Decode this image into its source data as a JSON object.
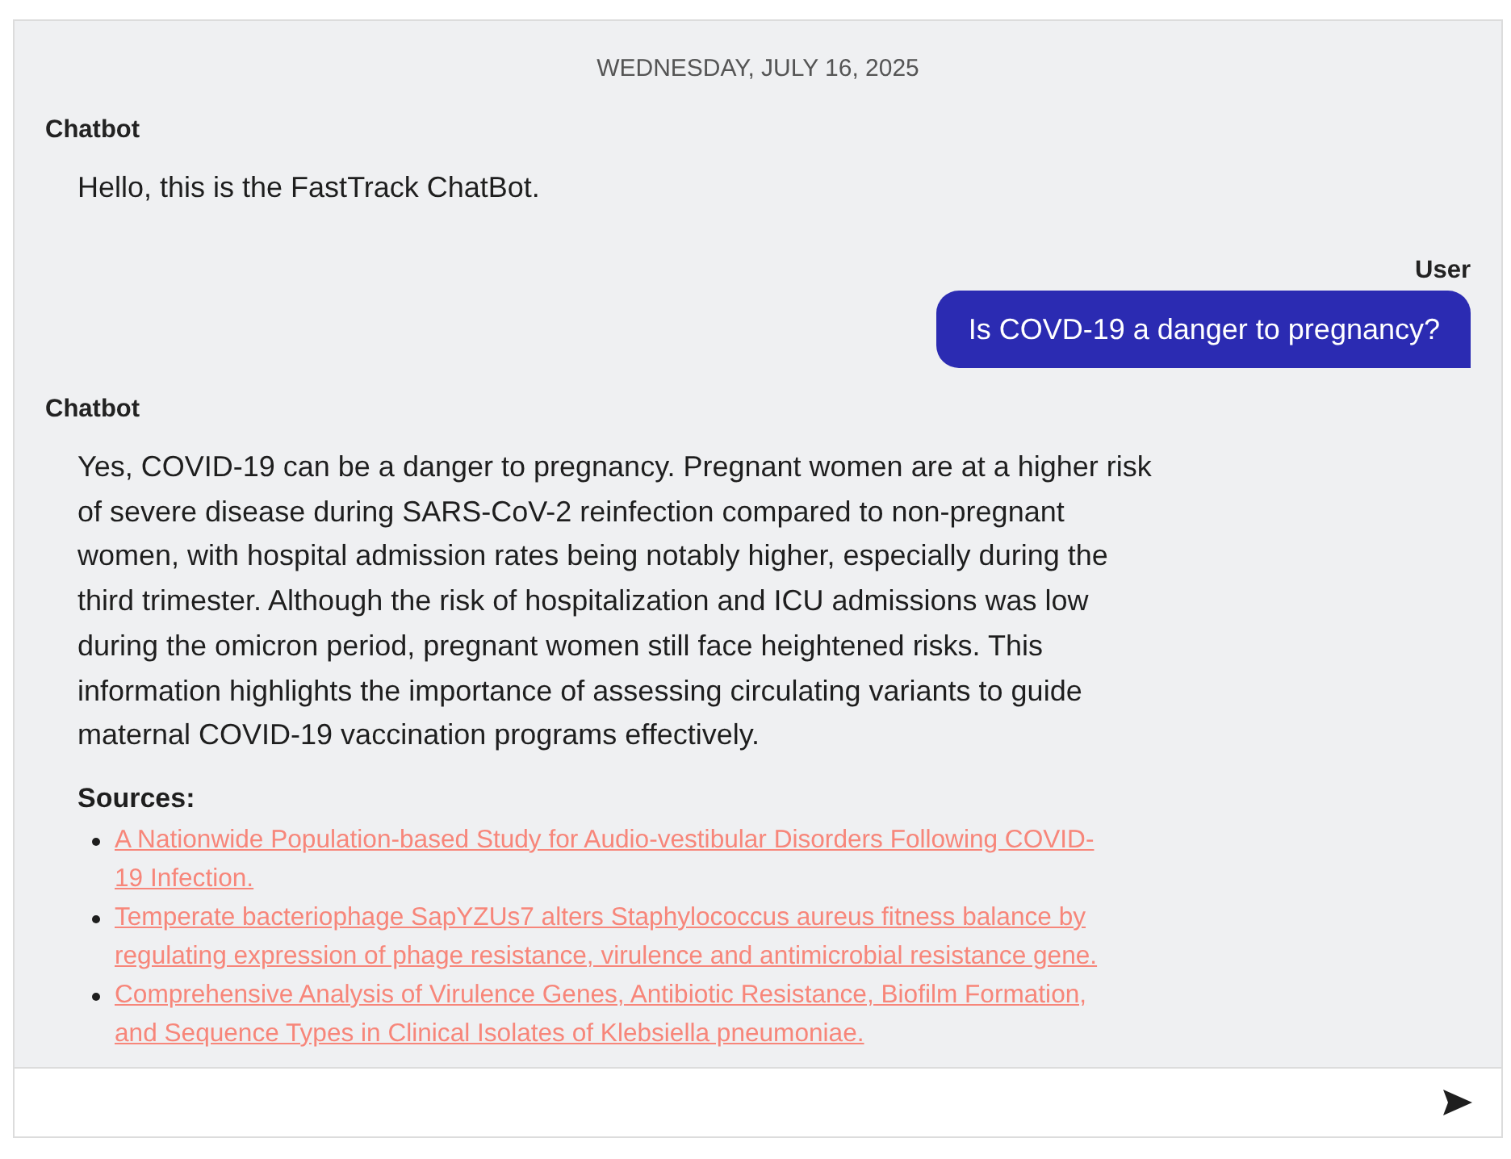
{
  "date_divider": "WEDNESDAY, JULY 16, 2025",
  "messages": [
    {
      "kind": "bot",
      "sender": "Chatbot",
      "text": "Hello, this is the FastTrack ChatBot."
    },
    {
      "kind": "user",
      "sender": "User",
      "text": "Is COVD-19 a danger to pregnancy?"
    },
    {
      "kind": "bot",
      "sender": "Chatbot",
      "text": "Yes, COVID-19 can be a danger to pregnancy. Pregnant women are at a higher risk of severe disease during SARS-CoV-2 reinfection compared to non-pregnant women, with hospital admission rates being notably higher, especially during the third trimester. Although the risk of hospitalization and ICU admissions was low during the omicron period, pregnant women still face heightened risks. This information highlights the importance of assessing circulating variants to guide maternal COVID-19 vaccination programs effectively.",
      "sources_heading": "Sources:",
      "sources": [
        "A Nationwide Population-based Study for Audio-vestibular Disorders Following COVID-19 Infection.",
        "Temperate bacteriophage SapYZUs7 alters Staphylococcus aureus fitness balance by regulating expression of phage resistance, virulence and antimicrobial resistance gene.",
        "Comprehensive Analysis of Virulence Genes, Antibiotic Resistance, Biofilm Formation, and Sequence Types in Clinical Isolates of Klebsiella pneumoniae."
      ]
    }
  ]
}
